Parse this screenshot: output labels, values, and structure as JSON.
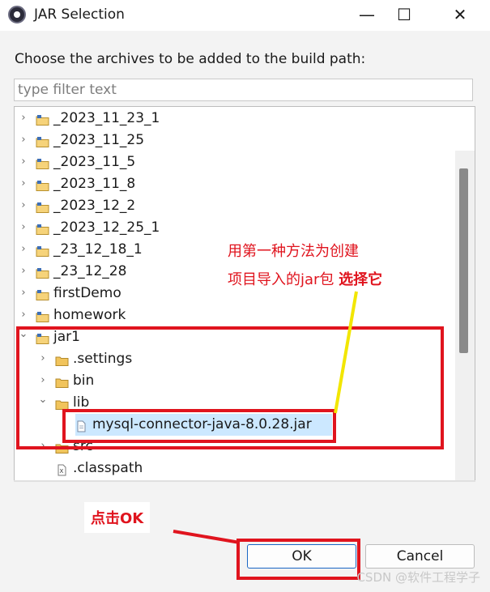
{
  "window": {
    "title": "JAR Selection",
    "minimize_glyph": "—",
    "maximize_glyph": "☐",
    "close_glyph": "✕"
  },
  "dialog": {
    "prompt": "Choose the archives to be added to the build path:",
    "filter_placeholder": "type filter text",
    "filter_value": ""
  },
  "tree": {
    "items": [
      {
        "label": "_2023_11_23_1",
        "level": 0,
        "expanded": false,
        "icon": "project-folder-icon"
      },
      {
        "label": "_2023_11_25",
        "level": 0,
        "expanded": false,
        "icon": "project-folder-icon"
      },
      {
        "label": "_2023_11_5",
        "level": 0,
        "expanded": false,
        "icon": "project-folder-icon"
      },
      {
        "label": "_2023_11_8",
        "level": 0,
        "expanded": false,
        "icon": "project-folder-icon"
      },
      {
        "label": "_2023_12_2",
        "level": 0,
        "expanded": false,
        "icon": "project-folder-icon"
      },
      {
        "label": "_2023_12_25_1",
        "level": 0,
        "expanded": false,
        "icon": "project-folder-icon"
      },
      {
        "label": "_23_12_18_1",
        "level": 0,
        "expanded": false,
        "icon": "project-folder-icon"
      },
      {
        "label": "_23_12_28",
        "level": 0,
        "expanded": false,
        "icon": "project-folder-icon"
      },
      {
        "label": "firstDemo",
        "level": 0,
        "expanded": false,
        "icon": "project-folder-icon"
      },
      {
        "label": "homework",
        "level": 0,
        "expanded": false,
        "icon": "project-folder-icon"
      },
      {
        "label": "jar1",
        "level": 0,
        "expanded": true,
        "icon": "project-folder-icon"
      },
      {
        "label": ".settings",
        "level": 1,
        "expanded": false,
        "icon": "folder-icon"
      },
      {
        "label": "bin",
        "level": 1,
        "expanded": false,
        "icon": "folder-icon"
      },
      {
        "label": "lib",
        "level": 1,
        "expanded": true,
        "icon": "folder-icon"
      },
      {
        "label": "mysql-connector-java-8.0.28.jar",
        "level": 2,
        "expanded": null,
        "icon": "jar-file-icon",
        "selected": true
      },
      {
        "label": "src",
        "level": 1,
        "expanded": false,
        "icon": "folder-icon"
      },
      {
        "label": ".classpath",
        "level": 1,
        "expanded": null,
        "icon": "xml-file-icon"
      }
    ]
  },
  "buttons": {
    "ok": "OK",
    "cancel": "Cancel"
  },
  "annotations": {
    "callout_line1": "用第一种方法为创建",
    "callout_line2": "项目导入的jar包",
    "callout_bold": "选择它",
    "click_ok": "点击OK"
  },
  "watermark": "CSDN @软件工程学子",
  "colors": {
    "annotation_red": "#e0141e",
    "annotation_yellow": "#f2e600",
    "selection": "#cce8ff",
    "ok_border": "#1a66c4"
  }
}
